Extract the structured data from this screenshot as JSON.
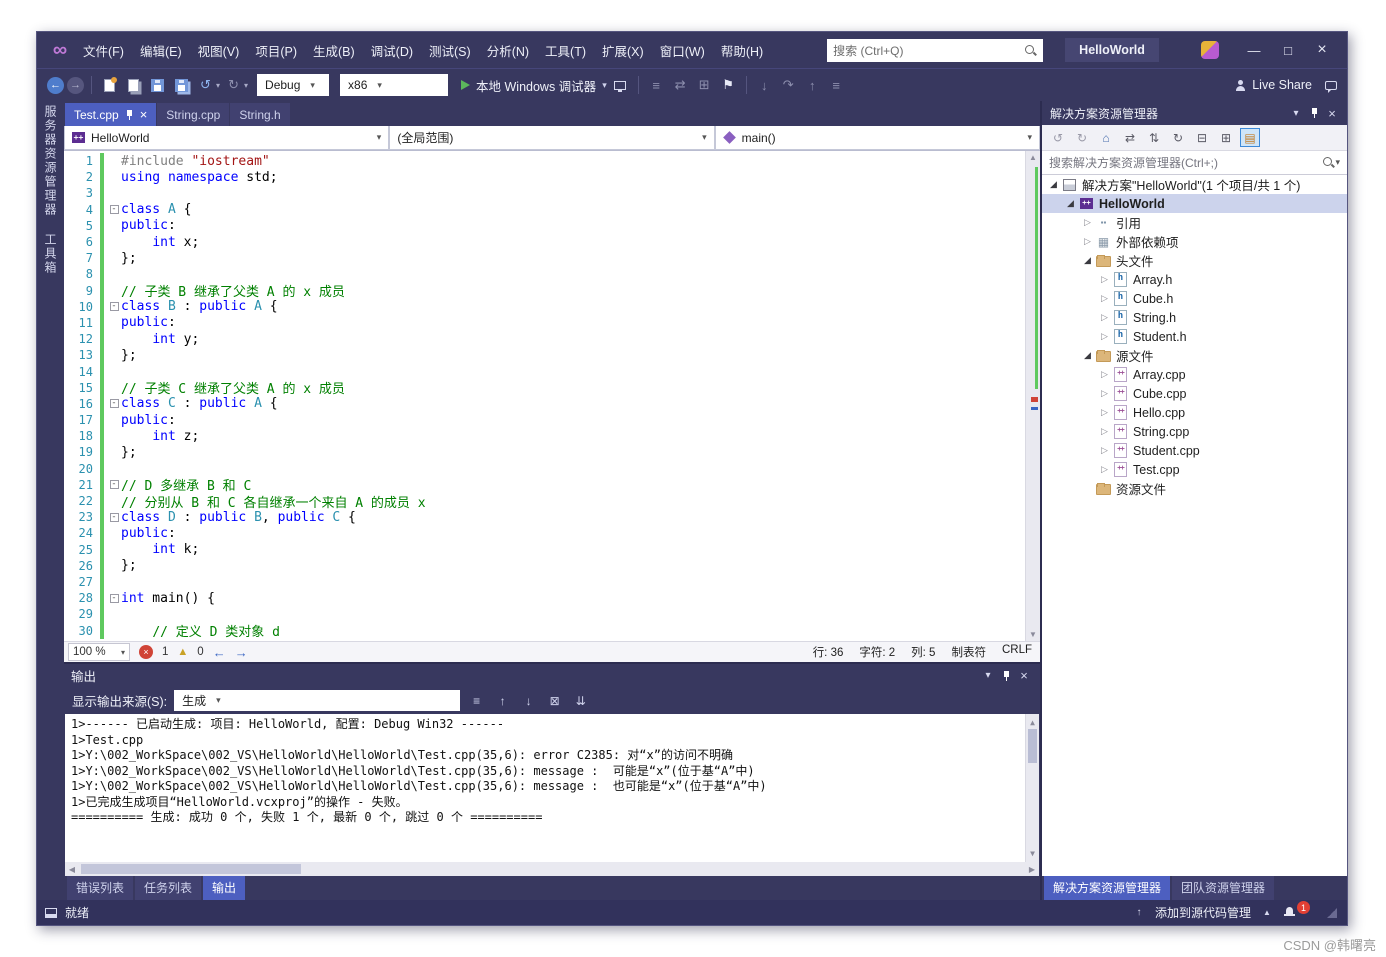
{
  "menu_bar": {
    "items": [
      "文件(F)",
      "编辑(E)",
      "视图(V)",
      "项目(P)",
      "生成(B)",
      "调试(D)",
      "测试(S)",
      "分析(N)",
      "工具(T)",
      "扩展(X)",
      "窗口(W)",
      "帮助(H)"
    ],
    "search_placeholder": "搜索 (Ctrl+Q)",
    "window_title": "HelloWorld"
  },
  "toolbar": {
    "config": "Debug",
    "platform": "x86",
    "run_label": "本地 Windows 调试器",
    "live_share_label": "Live Share"
  },
  "activity_strip": {
    "items": [
      "服务器资源管理器",
      "工具箱"
    ]
  },
  "editor": {
    "tabs": [
      {
        "label": "Test.cpp",
        "active": true,
        "pinned": true
      },
      {
        "label": "String.cpp",
        "active": false
      },
      {
        "label": "String.h",
        "active": false
      }
    ],
    "navigation": {
      "project": "HelloWorld",
      "scope": "(全局范围)",
      "member": "main()"
    },
    "code_lines": [
      {
        "n": "1",
        "fold": false,
        "segs": [
          [
            "pp",
            "#include "
          ],
          [
            "str",
            "\"iostream\""
          ]
        ]
      },
      {
        "n": "2",
        "fold": false,
        "segs": [
          [
            "kw",
            "using"
          ],
          [
            "pl",
            " "
          ],
          [
            "kw",
            "namespace"
          ],
          [
            "pl",
            " std;"
          ]
        ]
      },
      {
        "n": "3",
        "fold": false,
        "segs": []
      },
      {
        "n": "4",
        "fold": true,
        "segs": [
          [
            "kw",
            "class"
          ],
          [
            "pl",
            " "
          ],
          [
            "cls",
            "A"
          ],
          [
            "pl",
            " {"
          ]
        ]
      },
      {
        "n": "5",
        "fold": false,
        "segs": [
          [
            "kw",
            "public"
          ],
          [
            "pl",
            ":"
          ]
        ]
      },
      {
        "n": "6",
        "fold": false,
        "segs": [
          [
            "pl",
            "    "
          ],
          [
            "kw",
            "int"
          ],
          [
            "pl",
            " x;"
          ]
        ]
      },
      {
        "n": "7",
        "fold": false,
        "segs": [
          [
            "pl",
            "};"
          ]
        ]
      },
      {
        "n": "8",
        "fold": false,
        "segs": []
      },
      {
        "n": "9",
        "fold": false,
        "segs": [
          [
            "com",
            "// 子类 B 继承了父类 A 的 x 成员"
          ]
        ]
      },
      {
        "n": "10",
        "fold": true,
        "segs": [
          [
            "kw",
            "class"
          ],
          [
            "pl",
            " "
          ],
          [
            "cls",
            "B"
          ],
          [
            "pl",
            " : "
          ],
          [
            "kw",
            "public"
          ],
          [
            "pl",
            " "
          ],
          [
            "cls",
            "A"
          ],
          [
            "pl",
            " {"
          ]
        ]
      },
      {
        "n": "11",
        "fold": false,
        "segs": [
          [
            "kw",
            "public"
          ],
          [
            "pl",
            ":"
          ]
        ]
      },
      {
        "n": "12",
        "fold": false,
        "segs": [
          [
            "pl",
            "    "
          ],
          [
            "kw",
            "int"
          ],
          [
            "pl",
            " y;"
          ]
        ]
      },
      {
        "n": "13",
        "fold": false,
        "segs": [
          [
            "pl",
            "};"
          ]
        ]
      },
      {
        "n": "14",
        "fold": false,
        "segs": []
      },
      {
        "n": "15",
        "fold": false,
        "segs": [
          [
            "com",
            "// 子类 C 继承了父类 A 的 x 成员"
          ]
        ]
      },
      {
        "n": "16",
        "fold": true,
        "segs": [
          [
            "kw",
            "class"
          ],
          [
            "pl",
            " "
          ],
          [
            "cls",
            "C"
          ],
          [
            "pl",
            " : "
          ],
          [
            "kw",
            "public"
          ],
          [
            "pl",
            " "
          ],
          [
            "cls",
            "A"
          ],
          [
            "pl",
            " {"
          ]
        ]
      },
      {
        "n": "17",
        "fold": false,
        "segs": [
          [
            "kw",
            "public"
          ],
          [
            "pl",
            ":"
          ]
        ]
      },
      {
        "n": "18",
        "fold": false,
        "segs": [
          [
            "pl",
            "    "
          ],
          [
            "kw",
            "int"
          ],
          [
            "pl",
            " z;"
          ]
        ]
      },
      {
        "n": "19",
        "fold": false,
        "segs": [
          [
            "pl",
            "};"
          ]
        ]
      },
      {
        "n": "20",
        "fold": false,
        "segs": []
      },
      {
        "n": "21",
        "fold": true,
        "segs": [
          [
            "com",
            "// D 多继承 B 和 C"
          ]
        ]
      },
      {
        "n": "22",
        "fold": false,
        "segs": [
          [
            "com",
            "// 分别从 B 和 C 各自继承一个来自 A 的成员 x"
          ]
        ]
      },
      {
        "n": "23",
        "fold": true,
        "segs": [
          [
            "kw",
            "class"
          ],
          [
            "pl",
            " "
          ],
          [
            "cls",
            "D"
          ],
          [
            "pl",
            " : "
          ],
          [
            "kw",
            "public"
          ],
          [
            "pl",
            " "
          ],
          [
            "cls",
            "B"
          ],
          [
            "pl",
            ", "
          ],
          [
            "kw",
            "public"
          ],
          [
            "pl",
            " "
          ],
          [
            "cls",
            "C"
          ],
          [
            "pl",
            " {"
          ]
        ]
      },
      {
        "n": "24",
        "fold": false,
        "segs": [
          [
            "kw",
            "public"
          ],
          [
            "pl",
            ":"
          ]
        ]
      },
      {
        "n": "25",
        "fold": false,
        "segs": [
          [
            "pl",
            "    "
          ],
          [
            "kw",
            "int"
          ],
          [
            "pl",
            " k;"
          ]
        ]
      },
      {
        "n": "26",
        "fold": false,
        "segs": [
          [
            "pl",
            "};"
          ]
        ]
      },
      {
        "n": "27",
        "fold": false,
        "segs": []
      },
      {
        "n": "28",
        "fold": true,
        "segs": [
          [
            "kw",
            "int"
          ],
          [
            "pl",
            " main() {"
          ]
        ]
      },
      {
        "n": "29",
        "fold": false,
        "segs": []
      },
      {
        "n": "30",
        "fold": false,
        "segs": [
          [
            "pl",
            "    "
          ],
          [
            "com",
            "// 定义 D 类对象 d"
          ]
        ]
      }
    ],
    "status": {
      "zoom": "100 %",
      "error_count": "1",
      "warning_count": "0",
      "line": "行: 36",
      "character": "字符: 2",
      "column": "列: 5",
      "tabs": "制表符",
      "eol": "CRLF"
    }
  },
  "output_panel": {
    "title": "输出",
    "source_label": "显示输出来源(S):",
    "source_value": "生成",
    "lines": [
      "1>------ 已启动生成: 项目: HelloWorld, 配置: Debug Win32 ------",
      "1>Test.cpp",
      "1>Y:\\002_WorkSpace\\002_VS\\HelloWorld\\HelloWorld\\Test.cpp(35,6): error C2385: 对“x”的访问不明确",
      "1>Y:\\002_WorkSpace\\002_VS\\HelloWorld\\HelloWorld\\Test.cpp(35,6): message :  可能是“x”(位于基“A”中)",
      "1>Y:\\002_WorkSpace\\002_VS\\HelloWorld\\HelloWorld\\Test.cpp(35,6): message :  也可能是“x”(位于基“A”中)",
      "1>已完成生成项目“HelloWorld.vcxproj”的操作 - 失败。",
      "========== 生成: 成功 0 个, 失败 1 个, 最新 0 个, 跳过 0 个 =========="
    ],
    "panel_tabs": [
      {
        "label": "错误列表",
        "active": false
      },
      {
        "label": "任务列表",
        "active": false
      },
      {
        "label": "输出",
        "active": true
      }
    ]
  },
  "solution_explorer": {
    "title": "解决方案资源管理器",
    "search_placeholder": "搜索解决方案资源管理器(Ctrl+;)",
    "tree": [
      {
        "label": "解决方案\"HelloWorld\"(1 个项目/共 1 个)",
        "level": 0,
        "state": "expanded",
        "icon": "solution",
        "selected": false,
        "bold": false
      },
      {
        "label": "HelloWorld",
        "level": 1,
        "state": "expanded",
        "icon": "project",
        "selected": true,
        "bold": true
      },
      {
        "label": "引用",
        "level": 2,
        "state": "collapsed",
        "icon": "references",
        "selected": false,
        "bold": false
      },
      {
        "label": "外部依赖项",
        "level": 2,
        "state": "collapsed",
        "icon": "dependencies",
        "selected": false,
        "bold": false
      },
      {
        "label": "头文件",
        "level": 2,
        "state": "expanded",
        "icon": "folder",
        "selected": false,
        "bold": false
      },
      {
        "label": "Array.h",
        "level": 3,
        "state": "collapsed",
        "icon": "header",
        "selected": false,
        "bold": false
      },
      {
        "label": "Cube.h",
        "level": 3,
        "state": "collapsed",
        "icon": "header",
        "selected": false,
        "bold": false
      },
      {
        "label": "String.h",
        "level": 3,
        "state": "collapsed",
        "icon": "header",
        "selected": false,
        "bold": false
      },
      {
        "label": "Student.h",
        "level": 3,
        "state": "collapsed",
        "icon": "header",
        "selected": false,
        "bold": false
      },
      {
        "label": "源文件",
        "level": 2,
        "state": "expanded",
        "icon": "folder",
        "selected": false,
        "bold": false
      },
      {
        "label": "Array.cpp",
        "level": 3,
        "state": "collapsed",
        "icon": "cpp",
        "selected": false,
        "bold": false
      },
      {
        "label": "Cube.cpp",
        "level": 3,
        "state": "collapsed",
        "icon": "cpp",
        "selected": false,
        "bold": false
      },
      {
        "label": "Hello.cpp",
        "level": 3,
        "state": "collapsed",
        "icon": "cpp",
        "selected": false,
        "bold": false
      },
      {
        "label": "String.cpp",
        "level": 3,
        "state": "collapsed",
        "icon": "cpp",
        "selected": false,
        "bold": false
      },
      {
        "label": "Student.cpp",
        "level": 3,
        "state": "collapsed",
        "icon": "cpp",
        "selected": false,
        "bold": false
      },
      {
        "label": "Test.cpp",
        "level": 3,
        "state": "collapsed",
        "icon": "cpp",
        "selected": false,
        "bold": false
      },
      {
        "label": "资源文件",
        "level": 2,
        "state": "none",
        "icon": "folder",
        "selected": false,
        "bold": false
      }
    ],
    "bottom_tabs": [
      {
        "label": "解决方案资源管理器",
        "active": true
      },
      {
        "label": "团队资源管理器",
        "active": false
      }
    ]
  },
  "status_bar": {
    "left": "就绪",
    "source_control": "添加到源代码管理",
    "notification_count": "1"
  },
  "watermark": "CSDN @韩曙亮"
}
